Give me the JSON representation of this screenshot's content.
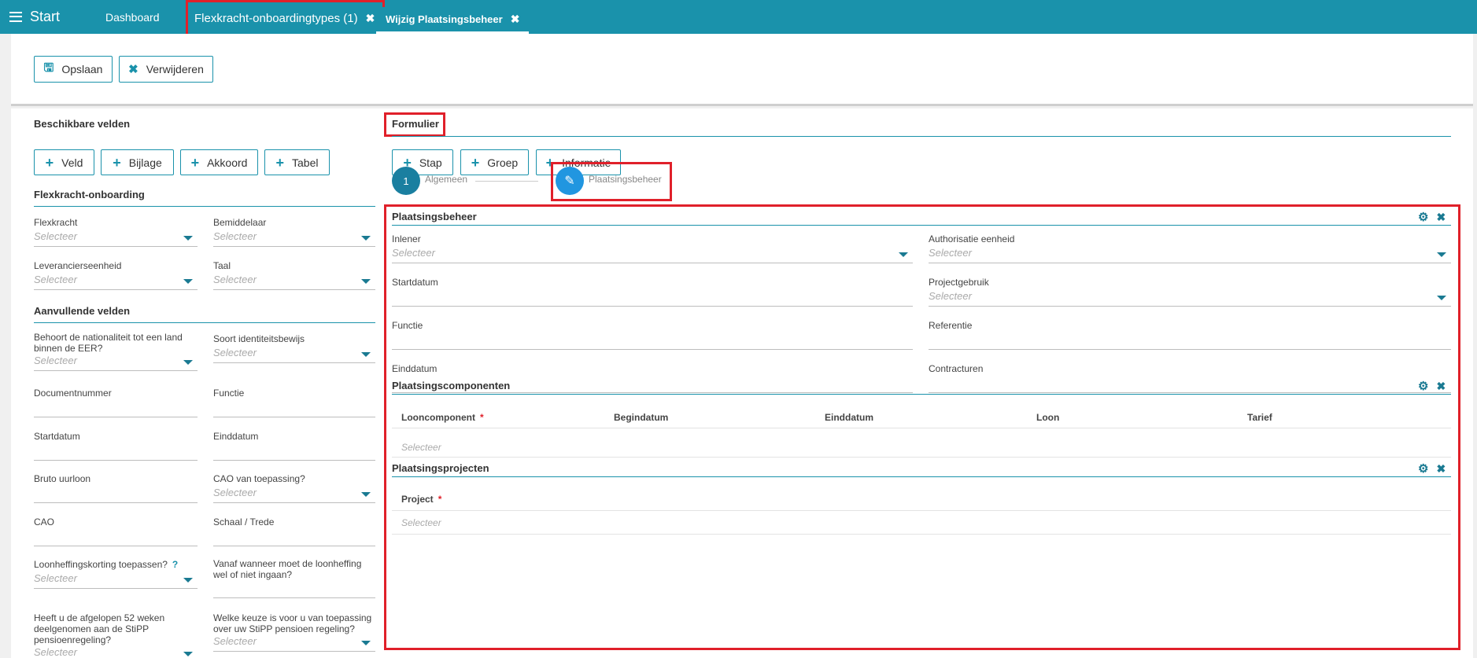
{
  "topbar": {
    "start": "Start",
    "tabs": [
      {
        "label": "Dashboard"
      },
      {
        "label": "Flexkracht-onboardingtypes (1)"
      },
      {
        "label": "Wijzig Plaatsingsbeheer"
      }
    ]
  },
  "toolbar": {
    "save": "Opslaan",
    "delete": "Verwijderen"
  },
  "left": {
    "title": "Beschikbare velden",
    "buttons": [
      "Veld",
      "Bijlage",
      "Akkoord",
      "Tabel"
    ],
    "section1": {
      "title": "Flexkracht-onboarding",
      "fields": [
        {
          "label": "Flexkracht",
          "value": "Selecteer"
        },
        {
          "label": "Bemiddelaar",
          "value": "Selecteer"
        },
        {
          "label": "Leverancierseenheid",
          "value": "Selecteer"
        },
        {
          "label": "Taal",
          "value": "Selecteer"
        }
      ]
    },
    "section2": {
      "title": "Aanvullende velden",
      "fields": [
        {
          "label": "Behoort de nationaliteit tot een land binnen de EER?",
          "value": "Selecteer"
        },
        {
          "label": "Soort identiteitsbewijs",
          "value": "Selecteer"
        },
        {
          "label": "Documentnummer"
        },
        {
          "label": "Functie"
        },
        {
          "label": "Startdatum"
        },
        {
          "label": "Einddatum"
        },
        {
          "label": "Bruto uurloon"
        },
        {
          "label": "CAO van toepassing?",
          "value": "Selecteer"
        },
        {
          "label": "CAO"
        },
        {
          "label": "Schaal / Trede"
        },
        {
          "label": "Loonheffingskorting toepassen?",
          "value": "Selecteer",
          "help": "?"
        },
        {
          "label": "Vanaf wanneer moet de loonheffing wel of niet ingaan?"
        },
        {
          "label": "Heeft u de afgelopen 52 weken deelgenomen aan de StiPP pensioenregeling?",
          "value": "Selecteer"
        },
        {
          "label": "Welke keuze is voor u van toepassing over uw StiPP pensioen regeling?",
          "value": "Selecteer"
        }
      ]
    }
  },
  "right": {
    "title": "Formulier",
    "buttons": [
      "Stap",
      "Groep",
      "Informatie"
    ],
    "steps": [
      {
        "num": "1",
        "label": "Algemeen"
      },
      {
        "label": "Plaatsingsbeheer"
      }
    ],
    "group1": {
      "title": "Plaatsingsbeheer",
      "fields": [
        {
          "label": "Inlener",
          "value": "Selecteer"
        },
        {
          "label": "Authorisatie eenheid",
          "value": "Selecteer"
        },
        {
          "label": "Startdatum"
        },
        {
          "label": "Projectgebruik",
          "value": "Selecteer"
        },
        {
          "label": "Functie"
        },
        {
          "label": "Referentie"
        },
        {
          "label": "Einddatum"
        },
        {
          "label": "Contracturen"
        }
      ]
    },
    "group2": {
      "title": "Plaatsingscomponenten",
      "columns": [
        "Looncomponent",
        "Begindatum",
        "Einddatum",
        "Loon",
        "Tarief"
      ],
      "required": "*",
      "row": "Selecteer"
    },
    "group3": {
      "title": "Plaatsingsprojecten",
      "columns": [
        "Project"
      ],
      "required": "*",
      "row": "Selecteer"
    }
  }
}
